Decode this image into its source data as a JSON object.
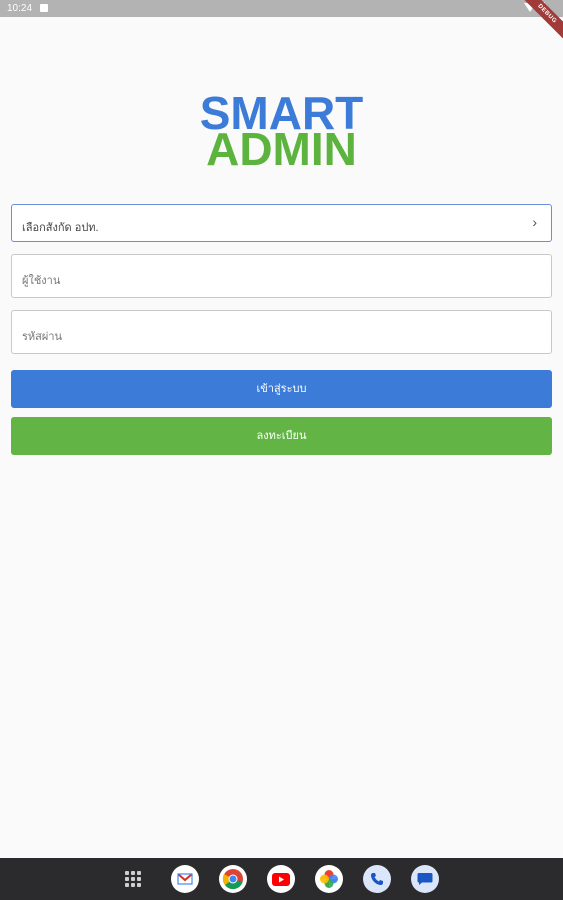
{
  "status_bar": {
    "time": "10:24"
  },
  "debug_banner": "DEBUG",
  "logo": {
    "line1": "SMART",
    "line2": "ADMIN",
    "color1": "#3c7bd8",
    "color2": "#5cb33e"
  },
  "form": {
    "select_label": "เลือกสังกัด อปท.",
    "username_placeholder": "ผู้ใช้งาน",
    "password_placeholder": "รหัสผ่าน",
    "login_label": "เข้าสู่ระบบ",
    "register_label": "ลงทะเบียน"
  },
  "colors": {
    "primary": "#3c7bd8",
    "success": "#62b544"
  },
  "nav": {
    "apps": [
      "apps-grid",
      "gmail",
      "chrome",
      "youtube",
      "photos",
      "phone",
      "messages"
    ]
  }
}
